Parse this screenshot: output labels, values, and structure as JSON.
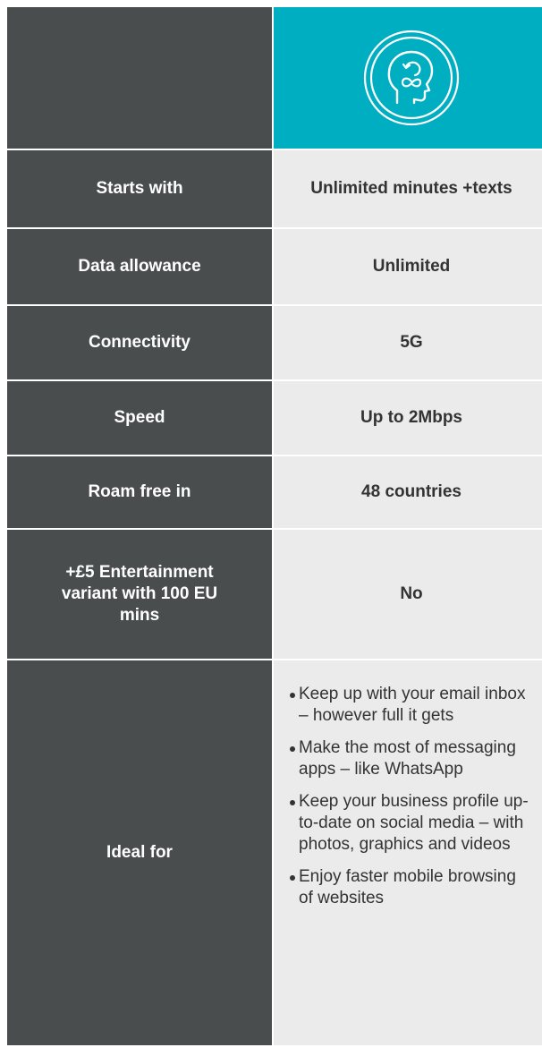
{
  "header": {
    "icon": "head-cycle-icon",
    "accent_color": "#00aec2"
  },
  "rows": [
    {
      "label": "Starts with",
      "value": "Unlimited minutes +texts"
    },
    {
      "label": "Data allowance",
      "value": "Unlimited"
    },
    {
      "label": "Connectivity",
      "value": "5G"
    },
    {
      "label": "Speed",
      "value": "Up to 2Mbps"
    },
    {
      "label": "Roam free in",
      "value": "48 countries"
    },
    {
      "label": "+£5 Entertainment variant with 100 EU mins",
      "value": "No"
    }
  ],
  "ideal": {
    "label": "Ideal for",
    "items": [
      "Keep up with your email inbox – however full it gets",
      "Make the most of messaging apps – like WhatsApp",
      "Keep your business profile up-to-date on social media – with photos, graphics and videos",
      "Enjoy faster mobile browsing of websites"
    ]
  }
}
